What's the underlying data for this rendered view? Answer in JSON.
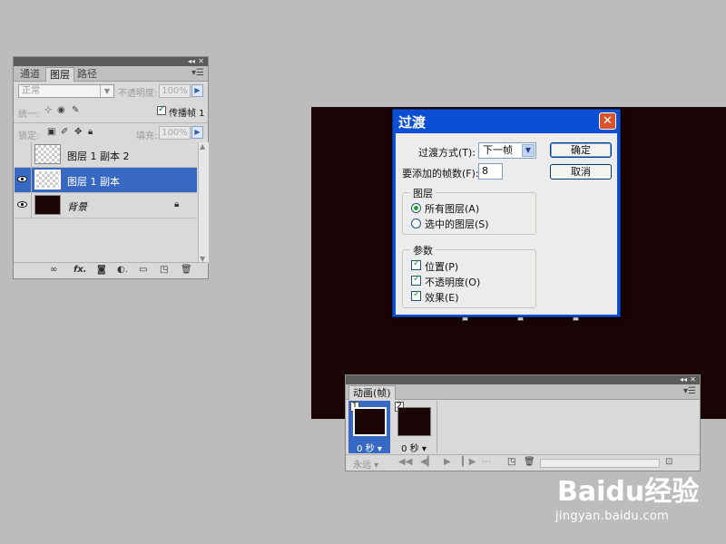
{
  "layers_panel": {
    "tabs": [
      "通道",
      "图层",
      "路径"
    ],
    "active_tab": 1,
    "blend_mode": "正常",
    "opacity_label": "不透明度:",
    "opacity_value": "100%",
    "unify_label": "统一:",
    "propagate_label": "传播帧 1",
    "propagate_checked": true,
    "lock_label": "锁定:",
    "fill_label": "填充:",
    "fill_value": "100%",
    "layers": [
      {
        "name": "图层 1 副本 2",
        "visible": false,
        "selected": false,
        "thumb": "transparent"
      },
      {
        "name": "图层 1 副本",
        "visible": true,
        "selected": true,
        "thumb": "transparent"
      },
      {
        "name": "背景",
        "visible": true,
        "selected": false,
        "thumb": "dark",
        "locked": true
      }
    ],
    "footer_icons": [
      "link-icon",
      "fx-icon",
      "mask-icon",
      "adjustment-icon",
      "group-folder-icon",
      "new-layer-icon",
      "trash-icon"
    ]
  },
  "dialog": {
    "title": "过渡",
    "close_glyph": "✕",
    "tween_with_label": "过渡方式(T):",
    "tween_with_value": "下一帧",
    "frames_label": "要添加的帧数(F):",
    "frames_value": "8",
    "ok_label": "确定",
    "cancel_label": "取消",
    "layers_group": {
      "title": "图层",
      "options": [
        {
          "label": "所有图层(A)",
          "selected": true
        },
        {
          "label": "选中的图层(S)",
          "selected": false
        }
      ]
    },
    "params_group": {
      "title": "参数",
      "options": [
        {
          "label": "位置(P)",
          "checked": true
        },
        {
          "label": "不透明度(O)",
          "checked": true
        },
        {
          "label": "效果(E)",
          "checked": true
        }
      ]
    }
  },
  "animation_panel": {
    "tab": "动画(帧)",
    "frames": [
      {
        "number": "1",
        "time": "0 秒",
        "selected": true
      },
      {
        "number": "2",
        "time": "0 秒",
        "selected": false
      }
    ],
    "loop_label": "永远"
  },
  "watermark": {
    "brand": "Baidu经验",
    "url": "jingyan.baidu.com"
  },
  "colors": {
    "canvas": "#1a0406",
    "selection_blue": "#3769c3",
    "dialog_titlebar": "#0d4fd4",
    "close_button": "#d9522c"
  }
}
